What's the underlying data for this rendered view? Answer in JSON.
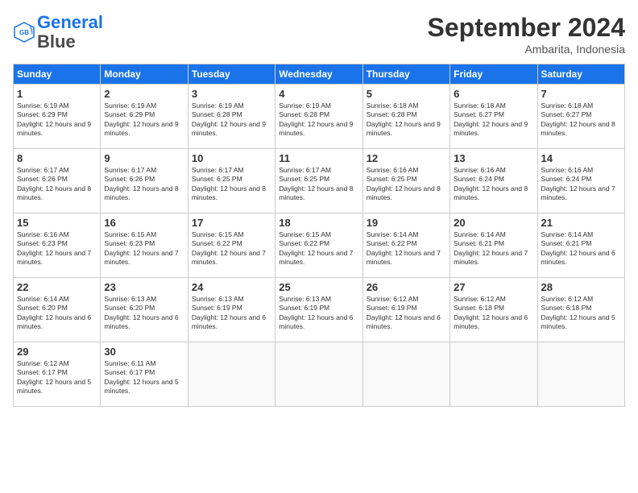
{
  "header": {
    "logo_line1": "General",
    "logo_line2": "Blue",
    "month_title": "September 2024",
    "location": "Ambarita, Indonesia"
  },
  "weekdays": [
    "Sunday",
    "Monday",
    "Tuesday",
    "Wednesday",
    "Thursday",
    "Friday",
    "Saturday"
  ],
  "weeks": [
    [
      {
        "day": "1",
        "sunrise": "6:19 AM",
        "sunset": "6:29 PM",
        "daylight": "12 hours and 9 minutes."
      },
      {
        "day": "2",
        "sunrise": "6:19 AM",
        "sunset": "6:29 PM",
        "daylight": "12 hours and 9 minutes."
      },
      {
        "day": "3",
        "sunrise": "6:19 AM",
        "sunset": "6:28 PM",
        "daylight": "12 hours and 9 minutes."
      },
      {
        "day": "4",
        "sunrise": "6:19 AM",
        "sunset": "6:28 PM",
        "daylight": "12 hours and 9 minutes."
      },
      {
        "day": "5",
        "sunrise": "6:18 AM",
        "sunset": "6:28 PM",
        "daylight": "12 hours and 9 minutes."
      },
      {
        "day": "6",
        "sunrise": "6:18 AM",
        "sunset": "6:27 PM",
        "daylight": "12 hours and 9 minutes."
      },
      {
        "day": "7",
        "sunrise": "6:18 AM",
        "sunset": "6:27 PM",
        "daylight": "12 hours and 8 minutes."
      }
    ],
    [
      {
        "day": "8",
        "sunrise": "6:17 AM",
        "sunset": "6:26 PM",
        "daylight": "12 hours and 8 minutes."
      },
      {
        "day": "9",
        "sunrise": "6:17 AM",
        "sunset": "6:26 PM",
        "daylight": "12 hours and 8 minutes."
      },
      {
        "day": "10",
        "sunrise": "6:17 AM",
        "sunset": "6:25 PM",
        "daylight": "12 hours and 8 minutes."
      },
      {
        "day": "11",
        "sunrise": "6:17 AM",
        "sunset": "6:25 PM",
        "daylight": "12 hours and 8 minutes."
      },
      {
        "day": "12",
        "sunrise": "6:16 AM",
        "sunset": "6:25 PM",
        "daylight": "12 hours and 8 minutes."
      },
      {
        "day": "13",
        "sunrise": "6:16 AM",
        "sunset": "6:24 PM",
        "daylight": "12 hours and 8 minutes."
      },
      {
        "day": "14",
        "sunrise": "6:16 AM",
        "sunset": "6:24 PM",
        "daylight": "12 hours and 7 minutes."
      }
    ],
    [
      {
        "day": "15",
        "sunrise": "6:16 AM",
        "sunset": "6:23 PM",
        "daylight": "12 hours and 7 minutes."
      },
      {
        "day": "16",
        "sunrise": "6:15 AM",
        "sunset": "6:23 PM",
        "daylight": "12 hours and 7 minutes."
      },
      {
        "day": "17",
        "sunrise": "6:15 AM",
        "sunset": "6:22 PM",
        "daylight": "12 hours and 7 minutes."
      },
      {
        "day": "18",
        "sunrise": "6:15 AM",
        "sunset": "6:22 PM",
        "daylight": "12 hours and 7 minutes."
      },
      {
        "day": "19",
        "sunrise": "6:14 AM",
        "sunset": "6:22 PM",
        "daylight": "12 hours and 7 minutes."
      },
      {
        "day": "20",
        "sunrise": "6:14 AM",
        "sunset": "6:21 PM",
        "daylight": "12 hours and 7 minutes."
      },
      {
        "day": "21",
        "sunrise": "6:14 AM",
        "sunset": "6:21 PM",
        "daylight": "12 hours and 6 minutes."
      }
    ],
    [
      {
        "day": "22",
        "sunrise": "6:14 AM",
        "sunset": "6:20 PM",
        "daylight": "12 hours and 6 minutes."
      },
      {
        "day": "23",
        "sunrise": "6:13 AM",
        "sunset": "6:20 PM",
        "daylight": "12 hours and 6 minutes."
      },
      {
        "day": "24",
        "sunrise": "6:13 AM",
        "sunset": "6:19 PM",
        "daylight": "12 hours and 6 minutes."
      },
      {
        "day": "25",
        "sunrise": "6:13 AM",
        "sunset": "6:19 PM",
        "daylight": "12 hours and 6 minutes."
      },
      {
        "day": "26",
        "sunrise": "6:12 AM",
        "sunset": "6:19 PM",
        "daylight": "12 hours and 6 minutes."
      },
      {
        "day": "27",
        "sunrise": "6:12 AM",
        "sunset": "6:18 PM",
        "daylight": "12 hours and 6 minutes."
      },
      {
        "day": "28",
        "sunrise": "6:12 AM",
        "sunset": "6:18 PM",
        "daylight": "12 hours and 5 minutes."
      }
    ],
    [
      {
        "day": "29",
        "sunrise": "6:12 AM",
        "sunset": "6:17 PM",
        "daylight": "12 hours and 5 minutes."
      },
      {
        "day": "30",
        "sunrise": "6:11 AM",
        "sunset": "6:17 PM",
        "daylight": "12 hours and 5 minutes."
      },
      null,
      null,
      null,
      null,
      null
    ]
  ]
}
